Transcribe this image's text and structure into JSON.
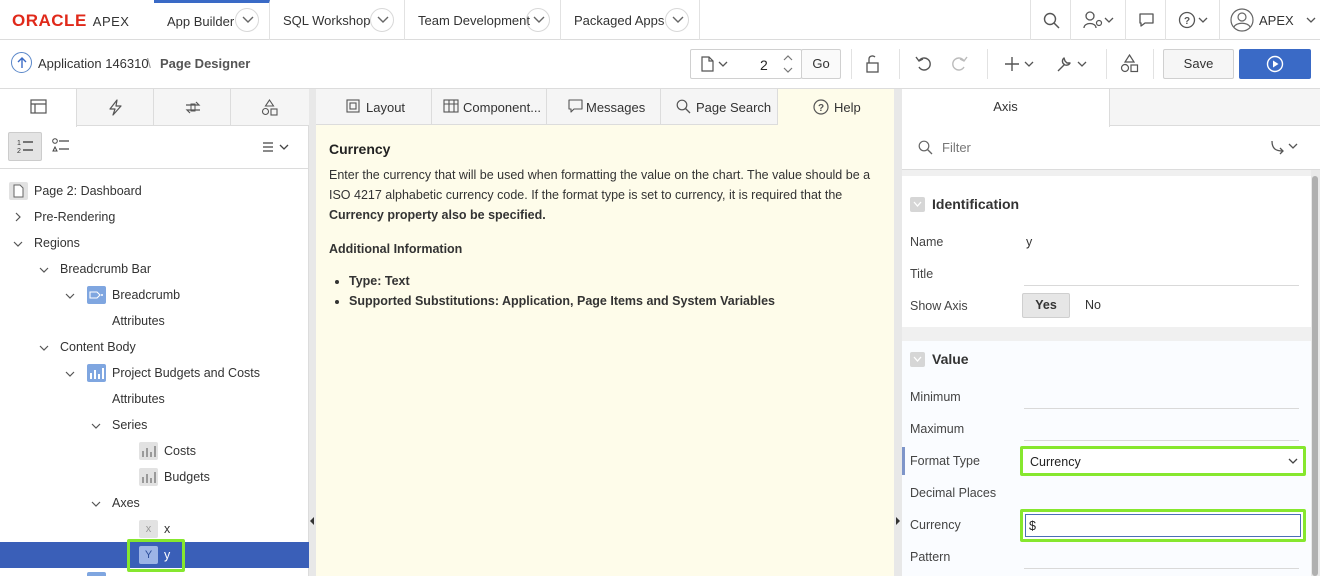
{
  "brand": {
    "oracle": "ORACLE",
    "apex": "APEX"
  },
  "topnav": {
    "tabs": [
      {
        "label": "App Builder"
      },
      {
        "label": "SQL Workshop"
      },
      {
        "label": "Team Development"
      },
      {
        "label": "Packaged Apps"
      }
    ],
    "user": "APEX"
  },
  "toolbar": {
    "app_crumb": "Application 146310",
    "separator": "\\",
    "current": "Page Designer",
    "page_number": "2",
    "go_label": "Go",
    "save_label": "Save"
  },
  "tree": {
    "nodes": [
      {
        "label": "Page 2: Dashboard"
      },
      {
        "label": "Pre-Rendering"
      },
      {
        "label": "Regions"
      },
      {
        "label": "Breadcrumb Bar"
      },
      {
        "label": "Breadcrumb"
      },
      {
        "label": "Attributes"
      },
      {
        "label": "Content Body"
      },
      {
        "label": "Project Budgets and Costs"
      },
      {
        "label": "Attributes"
      },
      {
        "label": "Series"
      },
      {
        "label": "Costs"
      },
      {
        "label": "Budgets"
      },
      {
        "label": "Axes"
      },
      {
        "label": "x"
      },
      {
        "label": "y"
      }
    ],
    "axis_icons": {
      "x": "x",
      "y": "Y"
    }
  },
  "center": {
    "tabs": [
      {
        "label": "Layout"
      },
      {
        "label": "Component..."
      },
      {
        "label": "Messages"
      },
      {
        "label": "Page Search"
      },
      {
        "label": "Help"
      }
    ],
    "help": {
      "title": "Currency",
      "body_pre": "Enter the currency that will be used when formatting the value on the chart. The value should be a ISO 4217 alphabetic currency code. If the format type is set to currency, it is required that the ",
      "body_bold": "Currency property also be specified.",
      "additional_heading": "Additional Information",
      "items": [
        "Type: Text",
        "Supported Substitutions: Application, Page Items and System Variables"
      ]
    }
  },
  "properties": {
    "tab_label": "Axis",
    "filter_placeholder": "Filter",
    "identification": {
      "heading": "Identification",
      "name_label": "Name",
      "name_value": "y",
      "title_label": "Title",
      "show_axis_label": "Show Axis",
      "yes_label": "Yes",
      "no_label": "No"
    },
    "value": {
      "heading": "Value",
      "minimum_label": "Minimum",
      "maximum_label": "Maximum",
      "format_type_label": "Format Type",
      "format_type_value": "Currency",
      "decimal_places_label": "Decimal Places",
      "currency_label": "Currency",
      "currency_value": "$",
      "pattern_label": "Pattern"
    }
  },
  "colors": {
    "accent": "#3a6ac6",
    "highlight": "#86e72e",
    "help_bg": "#fefcea",
    "oracle_red": "#e0291a"
  }
}
